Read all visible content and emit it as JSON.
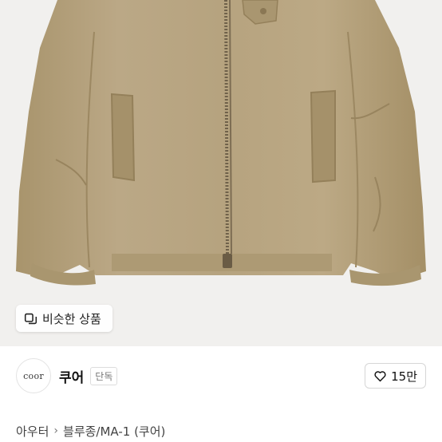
{
  "image": {
    "alt": "Khaki padded MA-1 blouson jacket"
  },
  "similar": {
    "label": "비슷한 상품",
    "icon": "similar-items-icon"
  },
  "shop": {
    "logo_text": "coor",
    "name": "쿠어",
    "badge": "단독"
  },
  "like": {
    "icon": "heart-icon",
    "count": "15만"
  },
  "breadcrumb": {
    "items": [
      "아우터",
      "블루종/MA-1 (쿠어)"
    ],
    "separator": "›"
  },
  "colors": {
    "jacket": "#b5a27c",
    "background": "#f1f0ee"
  }
}
